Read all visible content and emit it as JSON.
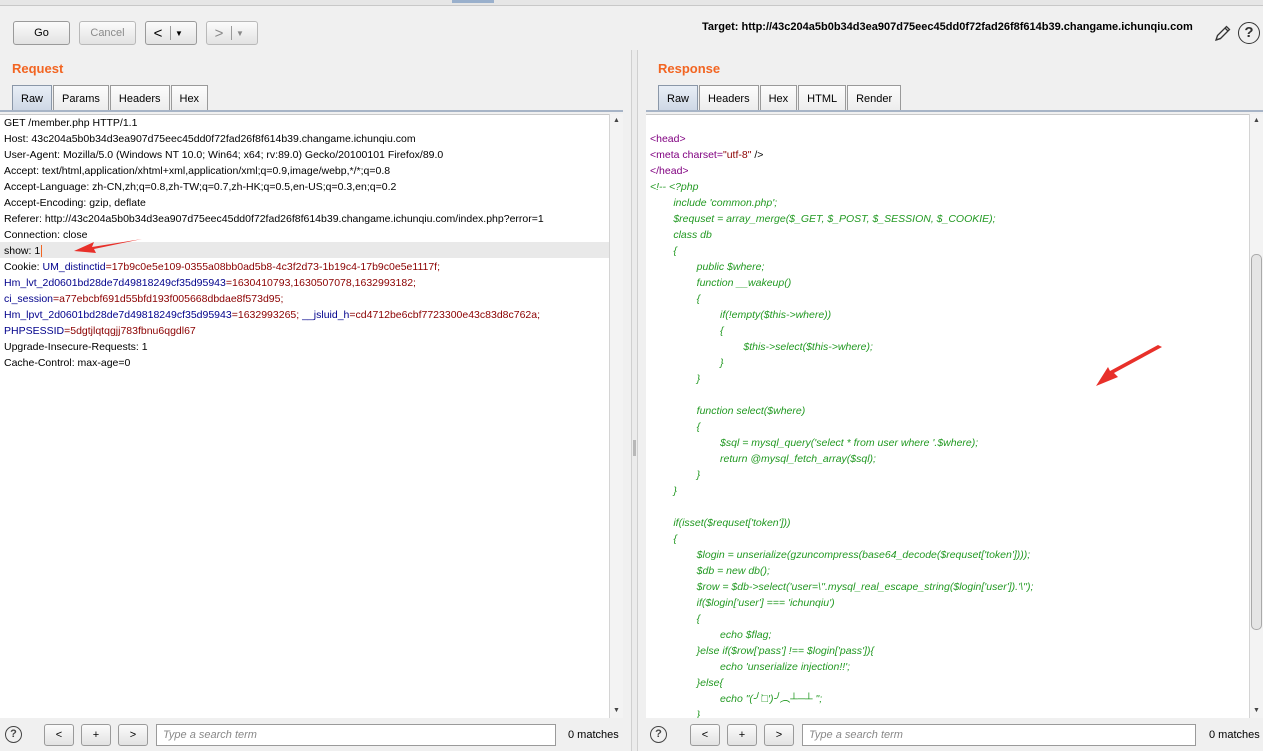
{
  "toolbar": {
    "go_label": "Go",
    "cancel_label": "Cancel",
    "back_label": "<",
    "forward_label": ">",
    "dropdown_glyph": "▼",
    "target_label": "Target: http://43c204a5b0b34d3ea907d75eec45dd0f72fad26f8f614b39.changame.ichunqiu.com",
    "help_glyph": "?"
  },
  "request": {
    "title": "Request",
    "tabs": [
      "Raw",
      "Params",
      "Headers",
      "Hex"
    ],
    "active_tab": "Raw",
    "lines": [
      "GET /member.php HTTP/1.1",
      "Host: 43c204a5b0b34d3ea907d75eec45dd0f72fad26f8f614b39.changame.ichunqiu.com",
      "User-Agent: Mozilla/5.0 (Windows NT 10.0; Win64; x64; rv:89.0) Gecko/20100101 Firefox/89.0",
      "Accept: text/html,application/xhtml+xml,application/xml;q=0.9,image/webp,*/*;q=0.8",
      "Accept-Language: zh-CN,zh;q=0.8,zh-TW;q=0.7,zh-HK;q=0.5,en-US;q=0.3,en;q=0.2",
      "Accept-Encoding: gzip, deflate",
      "Referer: http://43c204a5b0b34d3ea907d75eec45dd0f72fad26f8f614b39.changame.ichunqiu.com/index.php?error=1",
      "Connection: close",
      "show: 1"
    ],
    "cookie": {
      "prefix": "Cookie: ",
      "c1_name": "UM_distinctid",
      "c1_value": "=17b9c0e5e109-0355a08bb0ad5b8-4c3f2d73-1b19c4-17b9c0e5e1117f;",
      "c2_name": "Hm_lvt_2d0601bd28de7d49818249cf35d95943",
      "c2_value": "=1630410793,1630507078,1632993182;",
      "c3_name": "ci_session",
      "c3_value": "=a77ebcbf691d55bfd193f005668dbdae8f573d95;",
      "c4_name": "Hm_lpvt_2d0601bd28de7d49818249cf35d95943",
      "c4_value": "=1632993265;",
      "c5_name": "__jsluid_h",
      "c5_value": "=cd4712be6cbf7723300e43c83d8c762a;",
      "c6_name": "PHPSESSID",
      "c6_value": "=5dgtjlqtqgjj783fbnu6qgdl67"
    },
    "after_lines": [
      "Upgrade-Insecure-Requests: 1",
      "Cache-Control: max-age=0"
    ],
    "search_placeholder": "Type a search term",
    "matches": "0 matches"
  },
  "response": {
    "title": "Response",
    "tabs": [
      "Raw",
      "Headers",
      "Hex",
      "HTML",
      "Render"
    ],
    "active_tab": "Raw",
    "head_open": "<head>",
    "meta_tag": "<meta",
    "meta_attr": " charset=",
    "meta_val": "\"utf-8\"",
    "meta_close": " />",
    "head_close": "</head>",
    "code": [
      "<!-- <?php",
      "        include 'common.php';",
      "        $requset = array_merge($_GET, $_POST, $_SESSION, $_COOKIE);",
      "        class db",
      "        {",
      "                public $where;",
      "                function __wakeup()",
      "                {",
      "                        if(!empty($this->where))",
      "                        {",
      "                                $this->select($this->where);",
      "                        }",
      "                }",
      "",
      "                function select($where)",
      "                {",
      "                        $sql = mysql_query('select * from user where '.$where);",
      "                        return @mysql_fetch_array($sql);",
      "                }",
      "        }",
      "",
      "        if(isset($requset['token']))",
      "        {",
      "                $login = unserialize(gzuncompress(base64_decode($requset['token'])));",
      "                $db = new db();",
      "                $row = $db->select('user=\\''.mysql_real_escape_string($login['user']).'\\'');",
      "                if($login['user'] === 'ichunqiu')",
      "                {",
      "                        echo $flag;",
      "                }else if($row['pass'] !== $login['pass']){",
      "                        echo 'unserialize injection!!';",
      "                }else{",
      "                        echo \"(╯‵□′)╯︵┴─┴ \";",
      "                }"
    ],
    "search_placeholder": "Type a search term",
    "matches": "0 matches"
  },
  "search_controls": {
    "prev": "<",
    "add": "+",
    "next": ">",
    "help": "?"
  },
  "colors": {
    "title_orange": "#f26522",
    "annotation_arrow": "#e8302a",
    "php_green": "#229922",
    "tag_purple": "#800080",
    "cookie_name": "#00008b",
    "cookie_value": "#8b0000"
  },
  "icons": [
    "pencil-icon",
    "help-icon",
    "annotation-arrow"
  ]
}
